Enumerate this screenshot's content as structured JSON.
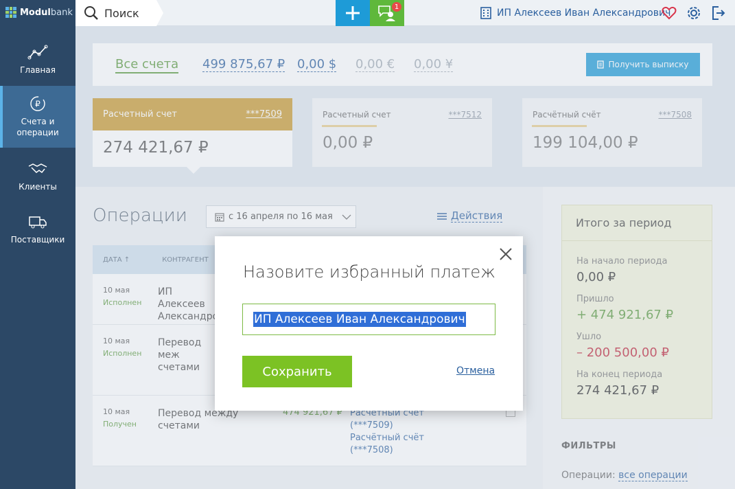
{
  "sidebar": {
    "logo_bold": "Modul",
    "logo_light": "bank",
    "items": [
      {
        "label": "Главная",
        "icon": "chart-line-icon"
      },
      {
        "label": "Счета и операции",
        "icon": "ruble-cycle-icon"
      },
      {
        "label": "Клиенты",
        "icon": "handshake-icon"
      },
      {
        "label": "Поставщики",
        "icon": "truck-icon"
      }
    ]
  },
  "topbar": {
    "search_label": "Поиск",
    "chat_badge": "1",
    "company": "ИП Алексеев Иван Александрович"
  },
  "summary": {
    "all_accounts": "Все счета",
    "rub": "499 875,67 ₽",
    "usd": "0,00 $",
    "eur": "0,00 €",
    "cny": "0,00 ¥",
    "statement_button": "Получить выписку"
  },
  "accounts": [
    {
      "title": "Расчетный счет",
      "number": "***7509",
      "amount": "274 421,67 ₽"
    },
    {
      "title": "Расчетный счет",
      "number": "***7512",
      "amount": "0,00 ₽"
    },
    {
      "title": "Расчётный счёт",
      "number": "***7508",
      "amount": "199 104,00 ₽"
    }
  ],
  "operations": {
    "title": "Операции",
    "period": "с 16 апреля по 16 мая",
    "actions": "Действия",
    "columns": {
      "date": "ДАТА",
      "counterparty": "КОНТРАГЕНТ"
    },
    "rows": [
      {
        "date": "10 мая",
        "status": "Исполнен",
        "counterparty": "ИП Алексеев Александров"
      },
      {
        "date": "10 мая",
        "status": "Исполнен",
        "counterparty": "Перевод меж счетами"
      },
      {
        "date": "10 мая",
        "status": "Получен",
        "counterparty": "Перевод между счетами",
        "amount": "474 921,67 ₽",
        "from": "Расчетный счёт (***7509)",
        "to": "Расчётный счёт (***7508)"
      }
    ]
  },
  "period_panel": {
    "title": "Итого за период",
    "start_label": "На начало периода",
    "start_value": "0,00  ₽",
    "in_label": "Пришло",
    "in_value": "+ 474 921,67 ₽",
    "out_label": "Ушло",
    "out_value": "– 200 500,00 ₽",
    "end_label": "На конец периода",
    "end_value": "274 421,67  ₽"
  },
  "filters": {
    "title": "ФИЛЬТРЫ",
    "ops_label": "Операции:",
    "ops_value": "все операции"
  },
  "modal": {
    "title": "Назовите избранный платеж",
    "input_value": "ИП Алексеев Иван Александрович",
    "save_label": "Сохранить",
    "cancel_label": "Отмена"
  },
  "colors": {
    "sidebar": "#2c4866",
    "accent_blue": "#1e9bd7",
    "accent_green": "#7cc224",
    "active_account": "#c99a30",
    "negative": "#c0263a"
  }
}
